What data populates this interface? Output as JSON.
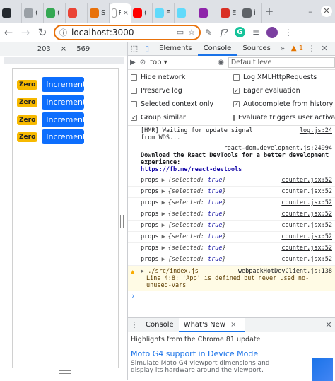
{
  "browser": {
    "tabs": [
      {
        "icon": "github-icon",
        "color": "#24292e",
        "title": "",
        "close": ""
      },
      {
        "icon": "circle-icon",
        "color": "#9aa0a6",
        "title": "(",
        "close": ""
      },
      {
        "icon": "ball-icon",
        "color": "#34a853",
        "title": "(",
        "close": ""
      },
      {
        "icon": "grid-icon",
        "color": "#ea4335",
        "title": "",
        "close": ""
      },
      {
        "icon": "page-icon",
        "color": "#e8710a",
        "title": "S",
        "close": ""
      },
      {
        "icon": "page-icon",
        "color": "#ffffff",
        "title": "R",
        "close": "×"
      },
      {
        "icon": "youtube-icon",
        "color": "#ff0000",
        "title": "(",
        "close": ""
      },
      {
        "icon": "react-icon",
        "color": "#61dafb",
        "title": "F",
        "close": ""
      },
      {
        "icon": "react-icon",
        "color": "#61dafb",
        "title": "",
        "close": ""
      },
      {
        "icon": "tab-icon",
        "color": "#8e24aa",
        "title": "",
        "close": ""
      },
      {
        "icon": "tab-icon",
        "color": "#d93025",
        "title": "E",
        "close": ""
      },
      {
        "icon": "tab-icon",
        "color": "#5f6368",
        "title": "i",
        "close": ""
      }
    ],
    "new_tab": "+",
    "minimize": "–",
    "close": "✕",
    "url": "localhost:3000"
  },
  "viewport": {
    "width": "203",
    "x": "×",
    "height": "569"
  },
  "app": {
    "rows": [
      {
        "zero": "Zero",
        "inc": "Increment"
      },
      {
        "zero": "Zero",
        "inc": "Increment"
      },
      {
        "zero": "Zero",
        "inc": "Increment"
      },
      {
        "zero": "Zero",
        "inc": "Increment"
      }
    ]
  },
  "devtools": {
    "tabs": [
      "Elements",
      "Console",
      "Sources"
    ],
    "active_tab": "Console",
    "warn_count": "1",
    "context": "top",
    "filter_placeholder": "Default leve",
    "settings": {
      "hide_network": "Hide network",
      "log_xhr": "Log XMLHttpRequests",
      "preserve_log": "Preserve log",
      "eager_eval": "Eager evaluation",
      "selected_ctx": "Selected context only",
      "autocomplete": "Autocomplete from history",
      "group_similar": "Group similar",
      "eval_triggers": "Evaluate triggers user activation"
    },
    "messages": {
      "hmr_text": "[HMR] Waiting for update signal from WDS...",
      "hmr_src": "log.js:24",
      "react_src": "react-dom.development.js:24994",
      "react_text": "Download the React DevTools for a better development experience:",
      "react_link": "https://fb.me/react-devtools",
      "props": [
        {
          "key": "props",
          "obj": "{selected: ",
          "val": "true",
          "end": "}",
          "src": "counter.jsx:52"
        },
        {
          "key": "props",
          "obj": "{selected: ",
          "val": "true",
          "end": "}",
          "src": "counter.jsx:52"
        },
        {
          "key": "props",
          "obj": "{selected: ",
          "val": "true",
          "end": "}",
          "src": "counter.jsx:52"
        },
        {
          "key": "props",
          "obj": "{selected: ",
          "val": "true",
          "end": "}",
          "src": "counter.jsx:52"
        },
        {
          "key": "props",
          "obj": "{selected: ",
          "val": "true",
          "end": "}",
          "src": "counter.jsx:52"
        },
        {
          "key": "props",
          "obj": "{selected: ",
          "val": "true",
          "end": "}",
          "src": "counter.jsx:52"
        },
        {
          "key": "props",
          "obj": "{selected: ",
          "val": "true",
          "end": "}",
          "src": "counter.jsx:52"
        },
        {
          "key": "props",
          "obj": "{selected: ",
          "val": "true",
          "end": "}",
          "src": "counter.jsx:52"
        }
      ],
      "warn_file": "./src/index.js",
      "warn_src": "webpackHotDevClient.js:138",
      "warn_text": "Line 4:8:  'App' is defined but never used  no-unused-vars"
    },
    "prompt": "›",
    "drawer": {
      "tabs": [
        "Console",
        "What's New"
      ],
      "active": "What's New",
      "close": "×",
      "highlights": "Highlights from the Chrome 81 update",
      "moto_title": "Moto G4 support in Device Mode",
      "moto_desc": "Simulate Moto G4 viewport dimensions and display its hardware around the viewport."
    }
  }
}
